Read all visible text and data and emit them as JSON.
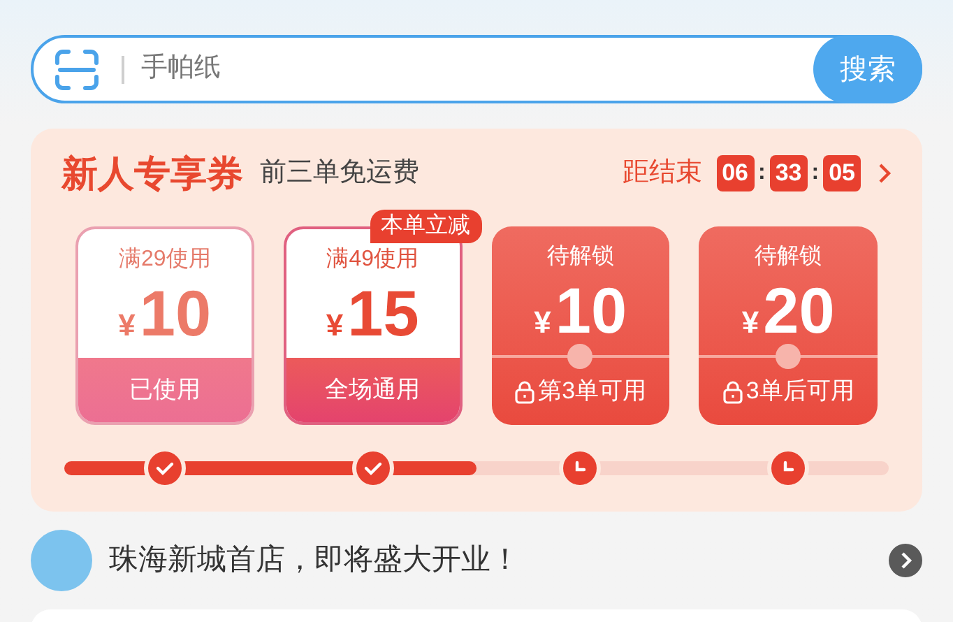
{
  "search": {
    "placeholder": "手帕纸",
    "button": "搜索"
  },
  "promo": {
    "title": "新人专享券",
    "subtitle": "前三单免运费",
    "countdown_label": "距结束",
    "countdown": [
      "06",
      "33",
      "05"
    ],
    "separator": ":",
    "coupons": [
      {
        "kind": "used",
        "top": "满29使用",
        "currency": "¥",
        "amount": "10",
        "bottom": "已使用"
      },
      {
        "kind": "available",
        "top": "满49使用",
        "currency": "¥",
        "amount": "15",
        "bottom": "全场通用",
        "badge": "本单立减"
      },
      {
        "kind": "locked",
        "top": "待解锁",
        "currency": "¥",
        "amount": "10",
        "bottom": "第3单可用"
      },
      {
        "kind": "locked",
        "top": "待解锁",
        "currency": "¥",
        "amount": "20",
        "bottom": "3单后可用"
      }
    ],
    "progress": {
      "level": 0.5,
      "milestones": [
        {
          "done": true
        },
        {
          "done": true
        },
        {
          "done": false
        },
        {
          "done": false
        }
      ]
    }
  },
  "notice": {
    "text": "珠海新城首店，即将盛大开业！"
  }
}
